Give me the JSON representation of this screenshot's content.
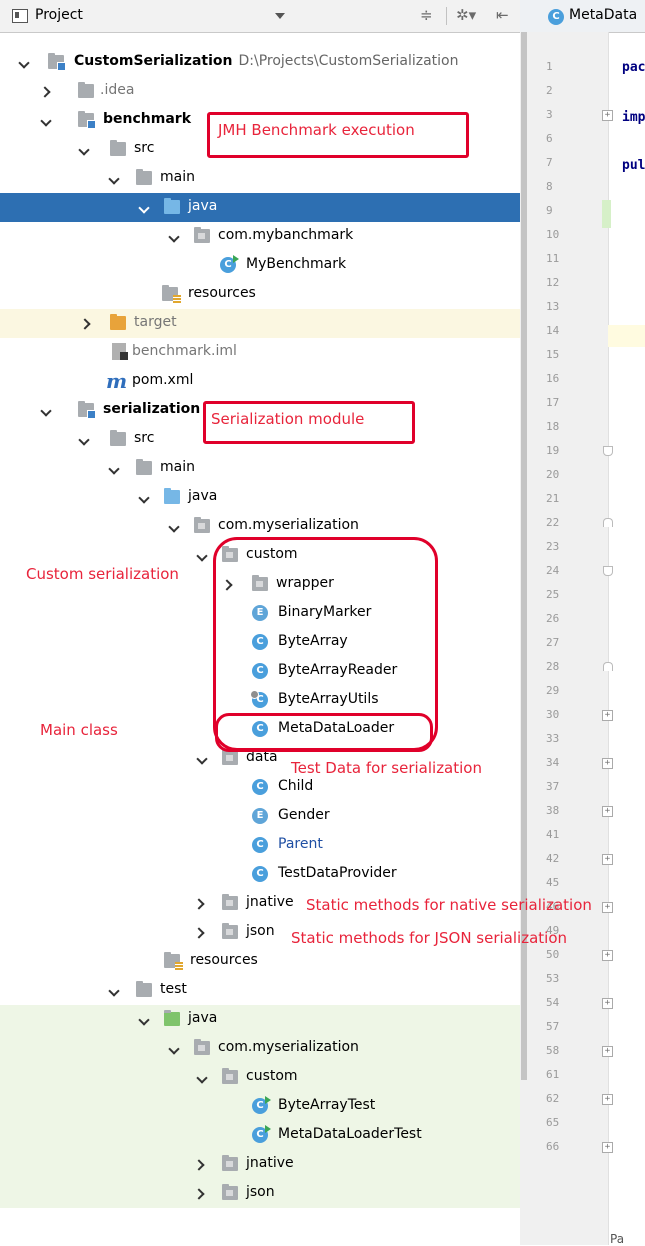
{
  "toolbar": {
    "project_label": "Project"
  },
  "editor_tab": {
    "label": "MetaData"
  },
  "tree": [
    {
      "label": "CustomSerialization",
      "path": "D:\\Projects\\CustomSerialization"
    },
    {
      "label": ".idea"
    },
    {
      "label": "benchmark"
    },
    {
      "label": "src"
    },
    {
      "label": "main"
    },
    {
      "label": "java"
    },
    {
      "label": "com.mybanchmark"
    },
    {
      "label": "MyBenchmark"
    },
    {
      "label": "resources"
    },
    {
      "label": "target"
    },
    {
      "label": "benchmark.iml"
    },
    {
      "label": "pom.xml"
    },
    {
      "label": "serialization"
    },
    {
      "label": "src"
    },
    {
      "label": "main"
    },
    {
      "label": "java"
    },
    {
      "label": "com.myserialization"
    },
    {
      "label": "custom"
    },
    {
      "label": "wrapper"
    },
    {
      "label": "BinaryMarker"
    },
    {
      "label": "ByteArray"
    },
    {
      "label": "ByteArrayReader"
    },
    {
      "label": "ByteArrayUtils"
    },
    {
      "label": "MetaDataLoader"
    },
    {
      "label": "data"
    },
    {
      "label": "Child"
    },
    {
      "label": "Gender"
    },
    {
      "label": "Parent"
    },
    {
      "label": "TestDataProvider"
    },
    {
      "label": "jnative"
    },
    {
      "label": "json"
    },
    {
      "label": "resources"
    },
    {
      "label": "test"
    },
    {
      "label": "java"
    },
    {
      "label": "com.myserialization"
    },
    {
      "label": "custom"
    },
    {
      "label": "ByteArrayTest"
    },
    {
      "label": "MetaDataLoaderTest"
    },
    {
      "label": "jnative"
    },
    {
      "label": "json"
    }
  ],
  "line_numbers": [
    "1",
    "2",
    "3",
    "6",
    "7",
    "8",
    "9",
    "10",
    "11",
    "12",
    "13",
    "14",
    "15",
    "16",
    "17",
    "18",
    "19",
    "20",
    "21",
    "22",
    "23",
    "24",
    "25",
    "26",
    "27",
    "28",
    "29",
    "30",
    "33",
    "34",
    "37",
    "38",
    "41",
    "42",
    "45",
    "46",
    "49",
    "50",
    "53",
    "54",
    "57",
    "58",
    "61",
    "62",
    "65",
    "66"
  ],
  "code": {
    "l1": "pac",
    "l3": "imp",
    "l7": "pul"
  },
  "bottom_tab": "Pa",
  "annotations": {
    "benchmark": "JMH Benchmark execution",
    "serialization": "Serialization module",
    "custom": "Custom serialization",
    "main_class": "Main class",
    "test_data": "Test Data for serialization",
    "native": "Static methods for native serialization",
    "json": "Static methods for JSON serialization"
  },
  "colors": {
    "annotation_red": "#e0002a",
    "selection_blue": "#2d6fb2",
    "folder_blue": "#76b7e6",
    "folder_orange": "#e8a33a"
  }
}
